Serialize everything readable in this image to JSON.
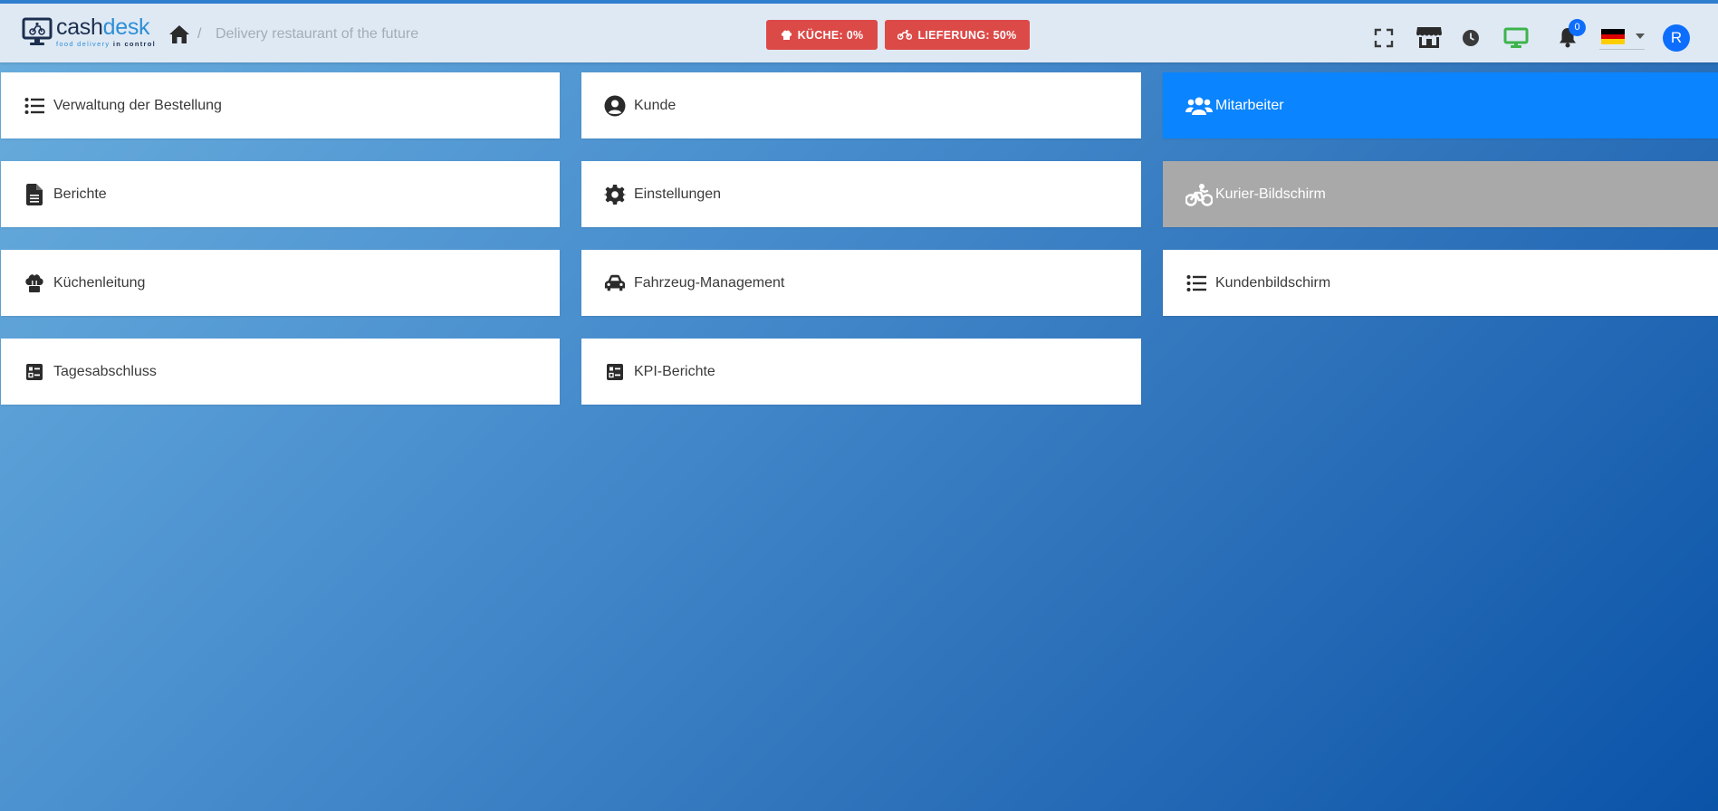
{
  "header": {
    "logo": {
      "word_dark": "cash",
      "word_blue": "desk",
      "tagline_light": "food delivery ",
      "tagline_bold": "in control"
    },
    "breadcrumb": {
      "separator": "/",
      "current": "Delivery restaurant of the future"
    },
    "status": {
      "kitchen_label": "KÜCHE: 0%",
      "delivery_label": "LIEFERUNG: 50%",
      "color": "#dc4a48"
    },
    "icons": [
      "fullscreen-icon",
      "store-icon",
      "clock-icon",
      "monitor-icon",
      "bell-icon"
    ],
    "notification_count": "0",
    "language_flag": "de-flag-icon",
    "user_initial": "R",
    "accent_color": "#0d6efd"
  },
  "tiles": [
    {
      "label": "Verwaltung der Bestellung",
      "icon": "list-icon",
      "state": "normal"
    },
    {
      "label": "Kunde",
      "icon": "user-circle-icon",
      "state": "normal"
    },
    {
      "label": "Mitarbeiter",
      "icon": "users-icon",
      "state": "active"
    },
    {
      "label": "Berichte",
      "icon": "document-icon",
      "state": "normal"
    },
    {
      "label": "Einstellungen",
      "icon": "gear-icon",
      "state": "normal"
    },
    {
      "label": "Kurier-Bildschirm",
      "icon": "bike-rider-icon",
      "state": "disabled"
    },
    {
      "label": "Küchenleitung",
      "icon": "chef-hat-icon",
      "state": "normal"
    },
    {
      "label": "Fahrzeug-Management",
      "icon": "car-icon",
      "state": "normal"
    },
    {
      "label": "Kundenbildschirm",
      "icon": "list-icon",
      "state": "normal"
    },
    {
      "label": "Tagesabschluss",
      "icon": "checklist-icon",
      "state": "normal"
    },
    {
      "label": "KPI-Berichte",
      "icon": "checklist-icon",
      "state": "normal"
    }
  ],
  "colors": {
    "active_tile": "#0a84ff",
    "disabled_tile": "#a9a9a9",
    "monitor_icon": "#3cb44b"
  }
}
